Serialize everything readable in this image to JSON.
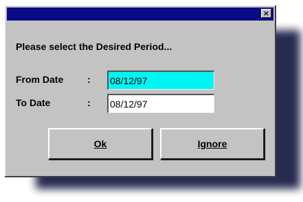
{
  "dialog": {
    "title": "",
    "close_glyph": "×",
    "prompt": "Please select the Desired Period...",
    "from": {
      "label": "From Date",
      "colon": ":",
      "value": "08/12/97"
    },
    "to": {
      "label": "To Date",
      "colon": ":",
      "value": "08/12/97"
    },
    "buttons": {
      "ok": "Ok",
      "ignore": "Ignore"
    }
  },
  "colors": {
    "titlebar": "#0a0a82",
    "dialog_face": "#c3c3c3",
    "selected_field": "#00f5f5",
    "shadow": "#1c1f46"
  }
}
